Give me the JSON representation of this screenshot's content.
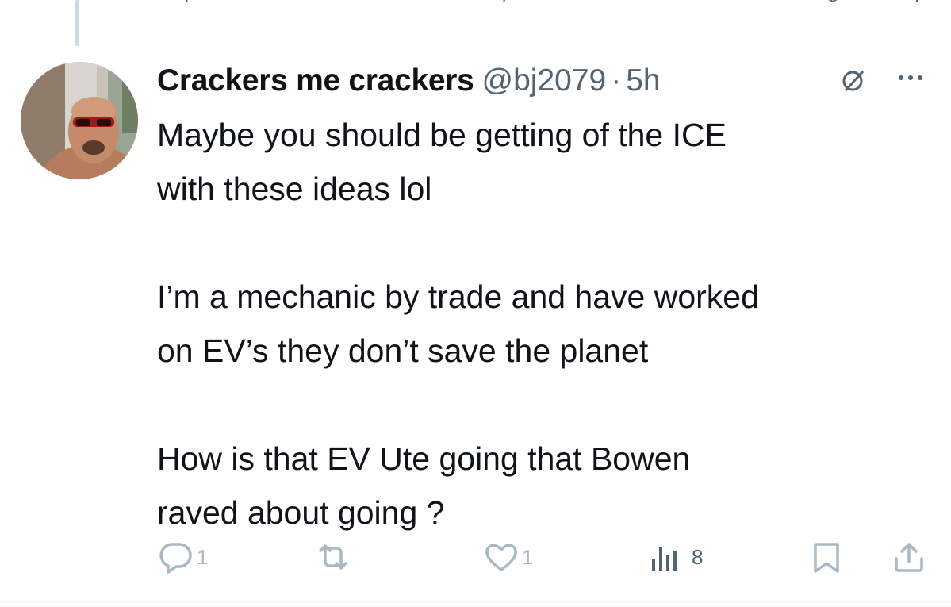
{
  "tweet": {
    "author_name": "Crackers me crackers",
    "handle": "@bj2079",
    "separator": "·",
    "time": "5h",
    "body": "Maybe you should be getting of the ICE\nwith these ideas lol\n\nI’m a mechanic by trade and have worked\non EV’s they don’t save the planet\n\nHow is that EV Ute going that Bowen\nraved about going ?",
    "icons": {
      "grok": "grok-icon",
      "more": "more-icon"
    }
  },
  "actions": {
    "reply_count": "1",
    "retweet_count": "",
    "like_count": "1",
    "views_count": "8"
  },
  "colors": {
    "text": "#0f1419",
    "secondary": "#536471",
    "muted_icon": "#aab8c2",
    "thread_line": "#cfd9de"
  }
}
